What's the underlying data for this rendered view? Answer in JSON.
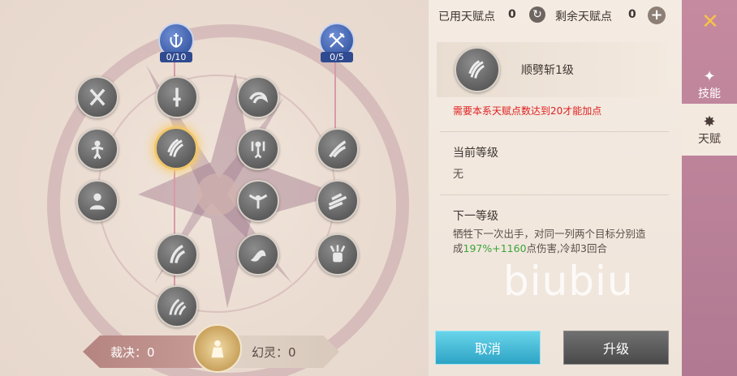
{
  "header": {
    "used_label": "已用天赋点",
    "used_value": "0",
    "remaining_label": "剩余天赋点",
    "remaining_value": "0"
  },
  "masters": [
    {
      "icon": "wreath-sword-icon",
      "count": "0/10"
    },
    {
      "icon": "crossed-swords-icon",
      "count": "0/5"
    }
  ],
  "skill_nodes": [
    {
      "icon": "crossed-blades-icon"
    },
    {
      "icon": "sword-icon"
    },
    {
      "icon": "swirl-slash-icon"
    },
    {
      "icon": "figure-burst-icon"
    },
    {
      "icon": "claw-slash-icon"
    },
    {
      "icon": "tentacle-figure-icon"
    },
    {
      "icon": "wing-slash-icon"
    },
    {
      "icon": "bust-figure-icon"
    },
    {
      "icon": "wing-guardian-icon"
    },
    {
      "icon": "dash-slash-icon"
    },
    {
      "icon": "double-slash-icon"
    },
    {
      "icon": "dragon-icon"
    },
    {
      "icon": "fist-blades-icon"
    },
    {
      "icon": "triple-slash-icon"
    }
  ],
  "detail": {
    "skill_name": "顺劈斩1级",
    "requirement": "需要本系天赋点数达到20才能加点",
    "current_level_label": "当前等级",
    "current_level_value": "无",
    "next_level_label": "下一等级",
    "next_desc_1": "牺牲下一次出手，对同一列两个目标分别造",
    "next_desc_2a": "成",
    "next_desc_2b": "197%+1160",
    "next_desc_2c": "点伤害,冷却3回合"
  },
  "bottom": {
    "judge_label": "裁决：0",
    "phantom_label": "幻灵：0"
  },
  "buttons": {
    "cancel": "取消",
    "upgrade": "升级"
  },
  "tabs": [
    {
      "label": "技能",
      "icon": "skill-tab-icon"
    },
    {
      "label": "天赋",
      "icon": "talent-tab-icon"
    }
  ],
  "watermark": "biubiu",
  "colors": {
    "requirement_red": "#e02020",
    "highlight_green": "#3aa53a",
    "cancel_blue": "#3cb8d6",
    "upgrade_gray": "#5a5a5a",
    "tab_pink": "#c58a9f"
  }
}
